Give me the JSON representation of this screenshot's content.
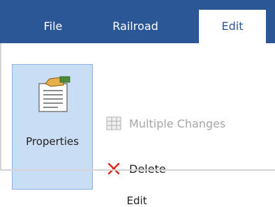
{
  "tabs": {
    "file": "File",
    "railroad": "Railroad",
    "edit": "Edit"
  },
  "ribbon": {
    "properties_label": "Properties",
    "multiple_changes_label": "Multiple Changes",
    "delete_label": "Delete",
    "group_label": "Edit"
  },
  "icons": {
    "properties": "properties-document-hand-icon",
    "multiple_changes": "grid-icon",
    "delete": "x-icon"
  },
  "colors": {
    "tab_bar": "#2b5797",
    "selected_button_bg": "#c9ddf4",
    "disabled_text": "#a6a6a6",
    "delete_red": "#e0241b"
  }
}
